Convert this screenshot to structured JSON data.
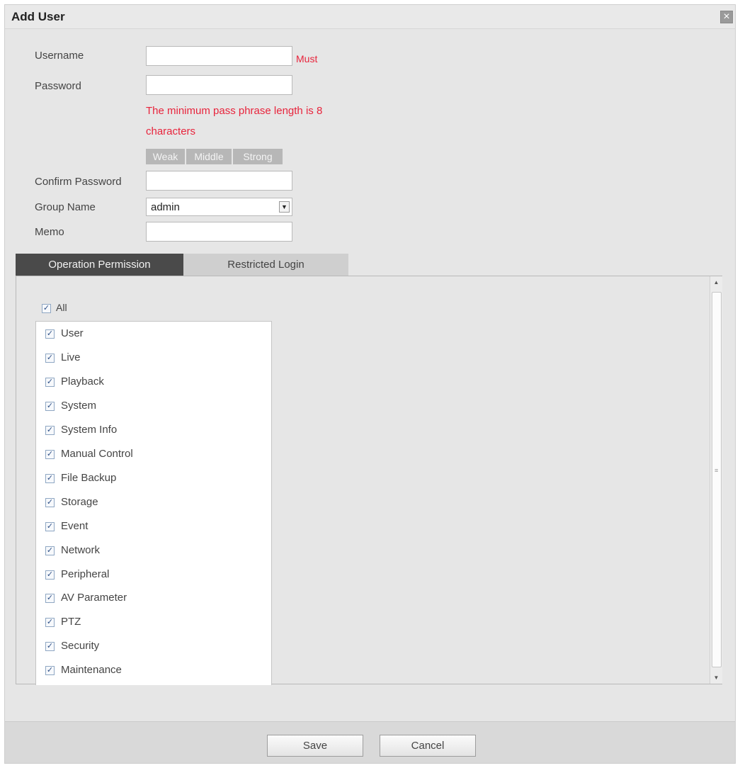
{
  "dialog": {
    "title": "Add User",
    "close_icon": "close-icon"
  },
  "form": {
    "username_label": "Username",
    "username_value": "",
    "must_text": "Must",
    "password_label": "Password",
    "password_value": "",
    "password_hint_line1": "The minimum pass phrase length is 8",
    "password_hint_line2": "characters",
    "strength": [
      "Weak",
      "Middle",
      "Strong"
    ],
    "confirm_password_label": "Confirm Password",
    "confirm_password_value": "",
    "group_name_label": "Group Name",
    "group_name_value": "admin",
    "memo_label": "Memo",
    "memo_value": ""
  },
  "tabs": [
    {
      "label": "Operation Permission",
      "active": true
    },
    {
      "label": "Restricted Login",
      "active": false
    }
  ],
  "permissions": {
    "all_label": "All",
    "all_checked": true,
    "items": [
      {
        "label": "User",
        "checked": true
      },
      {
        "label": "Live",
        "checked": true
      },
      {
        "label": "Playback",
        "checked": true
      },
      {
        "label": "System",
        "checked": true
      },
      {
        "label": "System Info",
        "checked": true
      },
      {
        "label": "Manual Control",
        "checked": true
      },
      {
        "label": "File Backup",
        "checked": true
      },
      {
        "label": "Storage",
        "checked": true
      },
      {
        "label": "Event",
        "checked": true
      },
      {
        "label": "Network",
        "checked": true
      },
      {
        "label": "Peripheral",
        "checked": true
      },
      {
        "label": "AV Parameter",
        "checked": true
      },
      {
        "label": "PTZ",
        "checked": true
      },
      {
        "label": "Security",
        "checked": true
      },
      {
        "label": "Maintenance",
        "checked": true
      }
    ]
  },
  "footer": {
    "save_label": "Save",
    "cancel_label": "Cancel"
  },
  "colors": {
    "required": "#e8243c",
    "tab_active_bg": "#4a4a4a",
    "dialog_bg": "#e6e6e6"
  }
}
